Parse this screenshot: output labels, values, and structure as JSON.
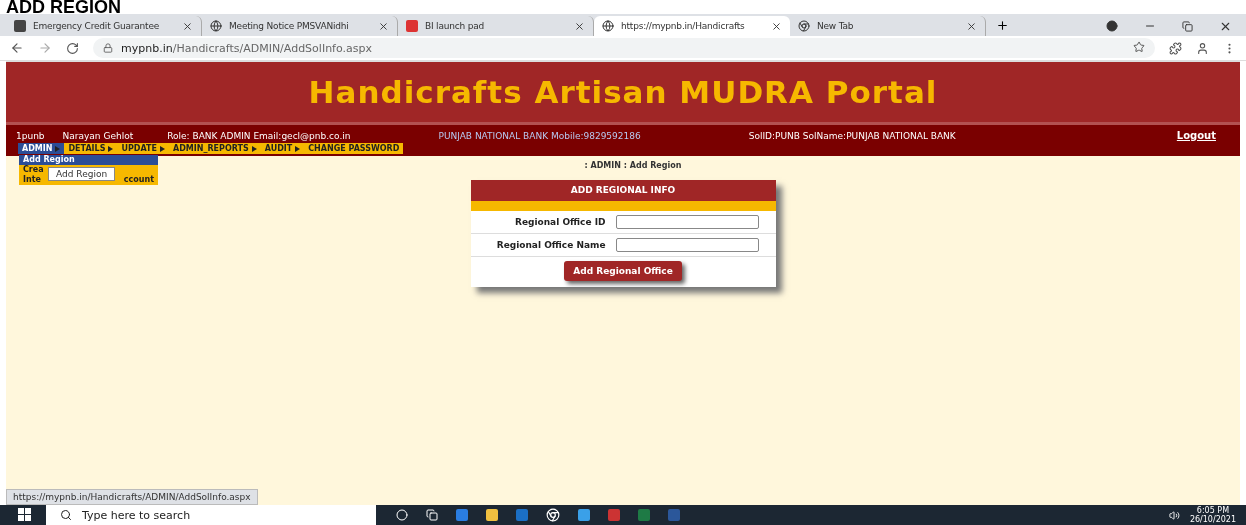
{
  "heading": "ADD REGION",
  "browser": {
    "tabs": [
      {
        "title": "Emergency Credit Guarantee",
        "selected": false
      },
      {
        "title": "Meeting Notice PMSVANidhi",
        "selected": false
      },
      {
        "title": "BI launch pad",
        "selected": false
      },
      {
        "title": "https://mypnb.in/Handicrafts",
        "selected": true
      },
      {
        "title": "New Tab",
        "selected": false
      }
    ],
    "url_host": "mypnb.in",
    "url_path": "/Handicrafts/ADMIN/AddSolInfo.aspx"
  },
  "banner": {
    "title": "Handicrafts Artisan MUDRA Portal"
  },
  "info_bar": {
    "user_id": "1punb",
    "user_name": "Narayan Gehlot",
    "role": "Role: BANK ADMIN Email:gecl@pnb.co.in",
    "bank": "PUNJAB NATIONAL BANK Mobile:9829592186",
    "sol": "SolID:PUNB SolName:PUNJAB NATIONAL BANK",
    "logout": "Logout"
  },
  "menu": [
    {
      "label": "ADMIN",
      "selected": true
    },
    {
      "label": "DETAILS",
      "selected": false
    },
    {
      "label": "UPDATE",
      "selected": false
    },
    {
      "label": "ADMIN_REPORTS",
      "selected": false
    },
    {
      "label": "AUDIT",
      "selected": false
    },
    {
      "label": "CHANGE PASSWORD",
      "selected": false
    }
  ],
  "submenu": [
    {
      "parts": [
        "Add Region"
      ],
      "selected": true
    },
    {
      "parts": [
        "Crea"
      ],
      "selected": false
    },
    {
      "parts": [
        "Inte",
        "ccount"
      ],
      "selected": false
    }
  ],
  "tooltip": "Add Region",
  "breadcrumb": ": ADMIN : Add Region",
  "form": {
    "title": "ADD REGIONAL INFO",
    "fields": [
      {
        "label": "Regional Office ID"
      },
      {
        "label": "Regional Office Name"
      }
    ],
    "submit": "Add Regional Office"
  },
  "status_url": "https://mypnb.in/Handicrafts/ADMIN/AddSolInfo.aspx",
  "taskbar": {
    "search_placeholder": "Type here to search",
    "time": "6:05 PM",
    "date": "26/10/2021"
  }
}
